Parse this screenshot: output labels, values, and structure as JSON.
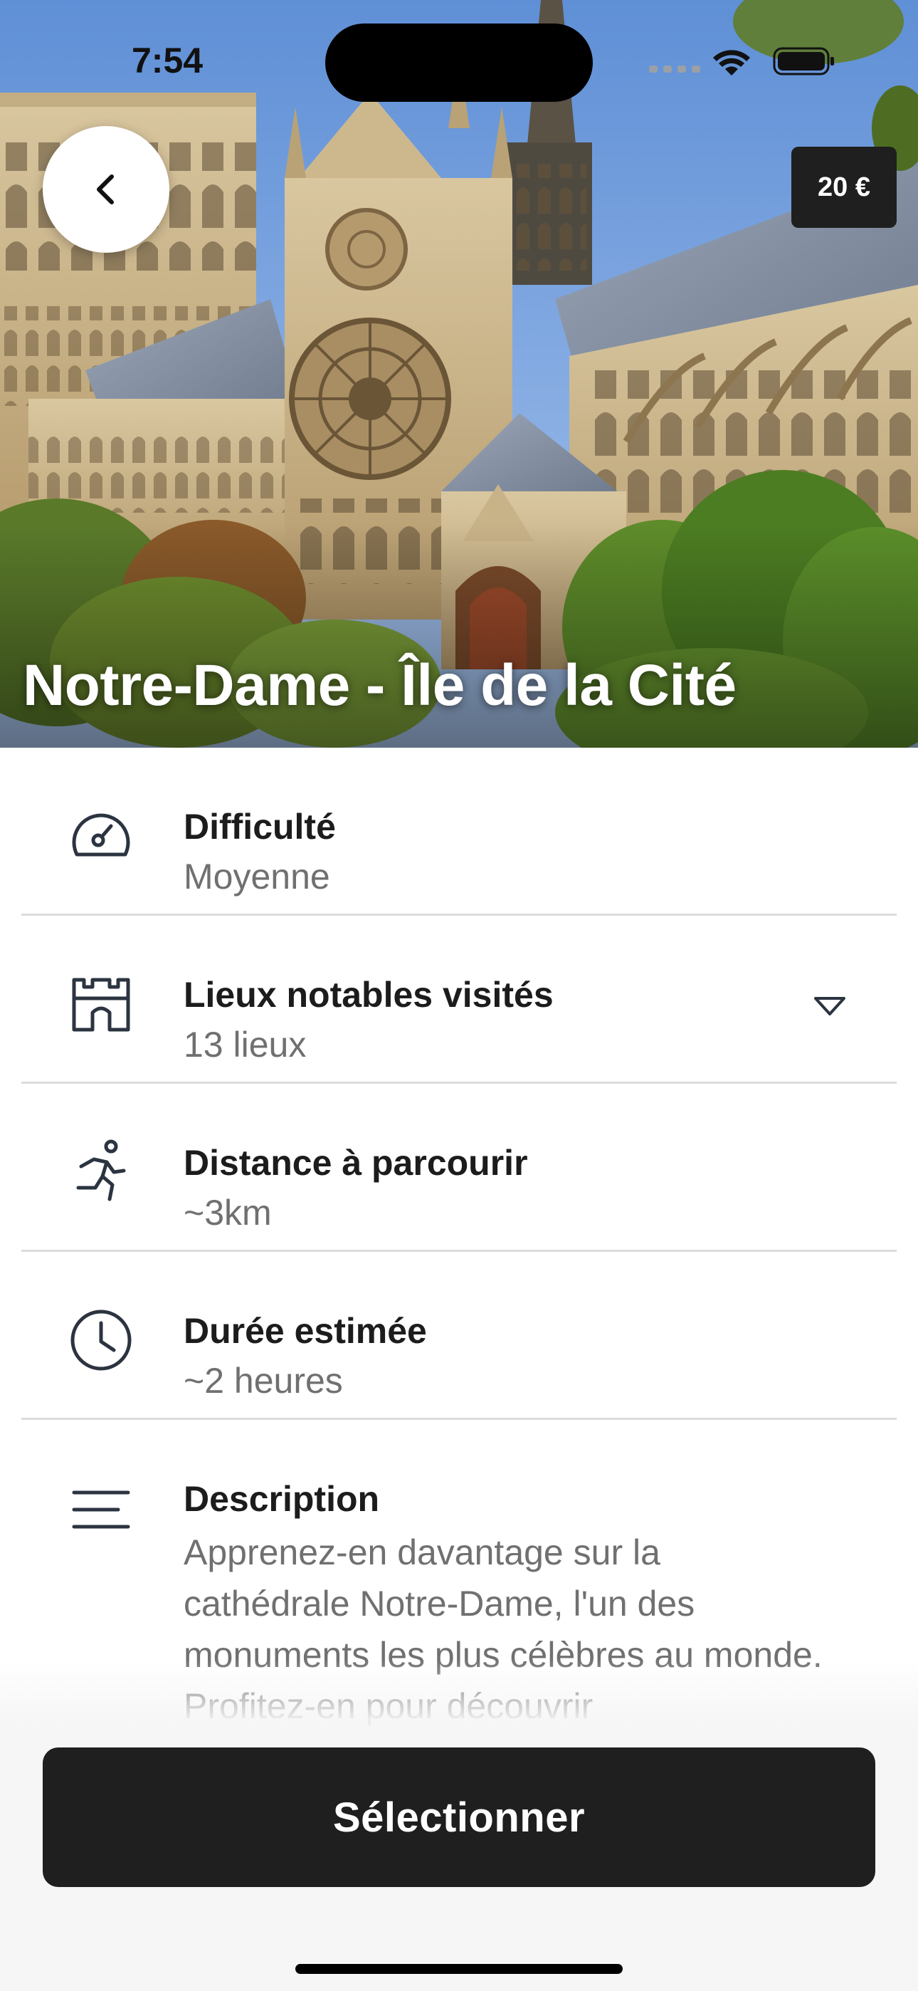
{
  "status_bar": {
    "time": "7:54"
  },
  "hero": {
    "title": "Notre-Dame - Île de la Cité",
    "price": "20 €",
    "back_icon": "chevron-left-icon"
  },
  "details": [
    {
      "icon": "speedometer-icon",
      "label": "Difficulté",
      "value": "Moyenne"
    },
    {
      "icon": "castle-icon",
      "label": "Lieux notables visités",
      "value": "13 lieux",
      "expandable": true
    },
    {
      "icon": "running-person-icon",
      "label": "Distance à parcourir",
      "value": "~3km"
    },
    {
      "icon": "clock-icon",
      "label": "Durée estimée",
      "value": "~2 heures"
    },
    {
      "icon": "menu-lines-icon",
      "label": "Description",
      "value": "Apprenez-en davantage sur la cathédrale Notre-Dame, l'un des monuments les plus célèbres au monde. Profitez-en pour découvrir"
    }
  ],
  "actions": {
    "select_label": "Sélectionner"
  },
  "colors": {
    "button_bg": "#1f1f1f",
    "label_text": "#1c1c1c",
    "value_text": "#707070",
    "icon_stroke": "#2b3440"
  }
}
